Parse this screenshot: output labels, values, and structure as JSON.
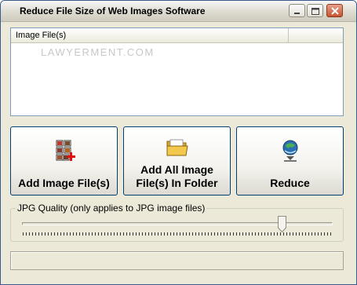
{
  "window": {
    "title": "Reduce File Size of Web Images Software",
    "controls": [
      "minimize",
      "maximize",
      "close"
    ]
  },
  "list": {
    "column_header": "Image File(s)",
    "watermark": "LAWYERMENT.COM"
  },
  "buttons": {
    "add_files": "Add Image File(s)",
    "add_folder": "Add All Image\nFile(s) In Folder",
    "reduce": "Reduce"
  },
  "quality": {
    "label": "JPG Quality (only applies to JPG image files)",
    "value_fraction": 0.84
  },
  "status": {
    "text": ""
  }
}
